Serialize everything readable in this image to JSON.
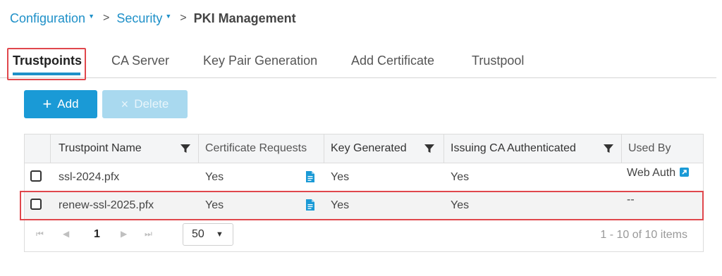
{
  "breadcrumb": {
    "items": [
      {
        "label": "Configuration"
      },
      {
        "label": "Security"
      }
    ],
    "separator": ">",
    "current": "PKI Management"
  },
  "tabs": [
    {
      "label": "Trustpoints",
      "active": true
    },
    {
      "label": "CA Server"
    },
    {
      "label": "Key Pair Generation"
    },
    {
      "label": "Add Certificate"
    },
    {
      "label": "Trustpool"
    }
  ],
  "toolbar": {
    "add_label": "Add",
    "add_icon": "plus-icon",
    "delete_label": "Delete",
    "delete_icon": "x-icon"
  },
  "table": {
    "columns": [
      "Trustpoint Name",
      "Certificate Requests",
      "Key Generated",
      "Issuing CA Authenticated",
      "Used By"
    ],
    "rows": [
      {
        "name": "ssl-2024.pfx",
        "cert_requests": "Yes",
        "key_generated": "Yes",
        "ca_authenticated": "Yes",
        "used_by": "Web Auth"
      },
      {
        "name": "renew-ssl-2025.pfx",
        "cert_requests": "Yes",
        "key_generated": "Yes",
        "ca_authenticated": "Yes",
        "used_by": "--"
      }
    ]
  },
  "pager": {
    "current_page": "1",
    "page_size": "50",
    "info": "1 - 10 of 10 items"
  },
  "colors": {
    "accent": "#1a9ad6",
    "link": "#1e90c8",
    "highlight": "#e0474c"
  }
}
